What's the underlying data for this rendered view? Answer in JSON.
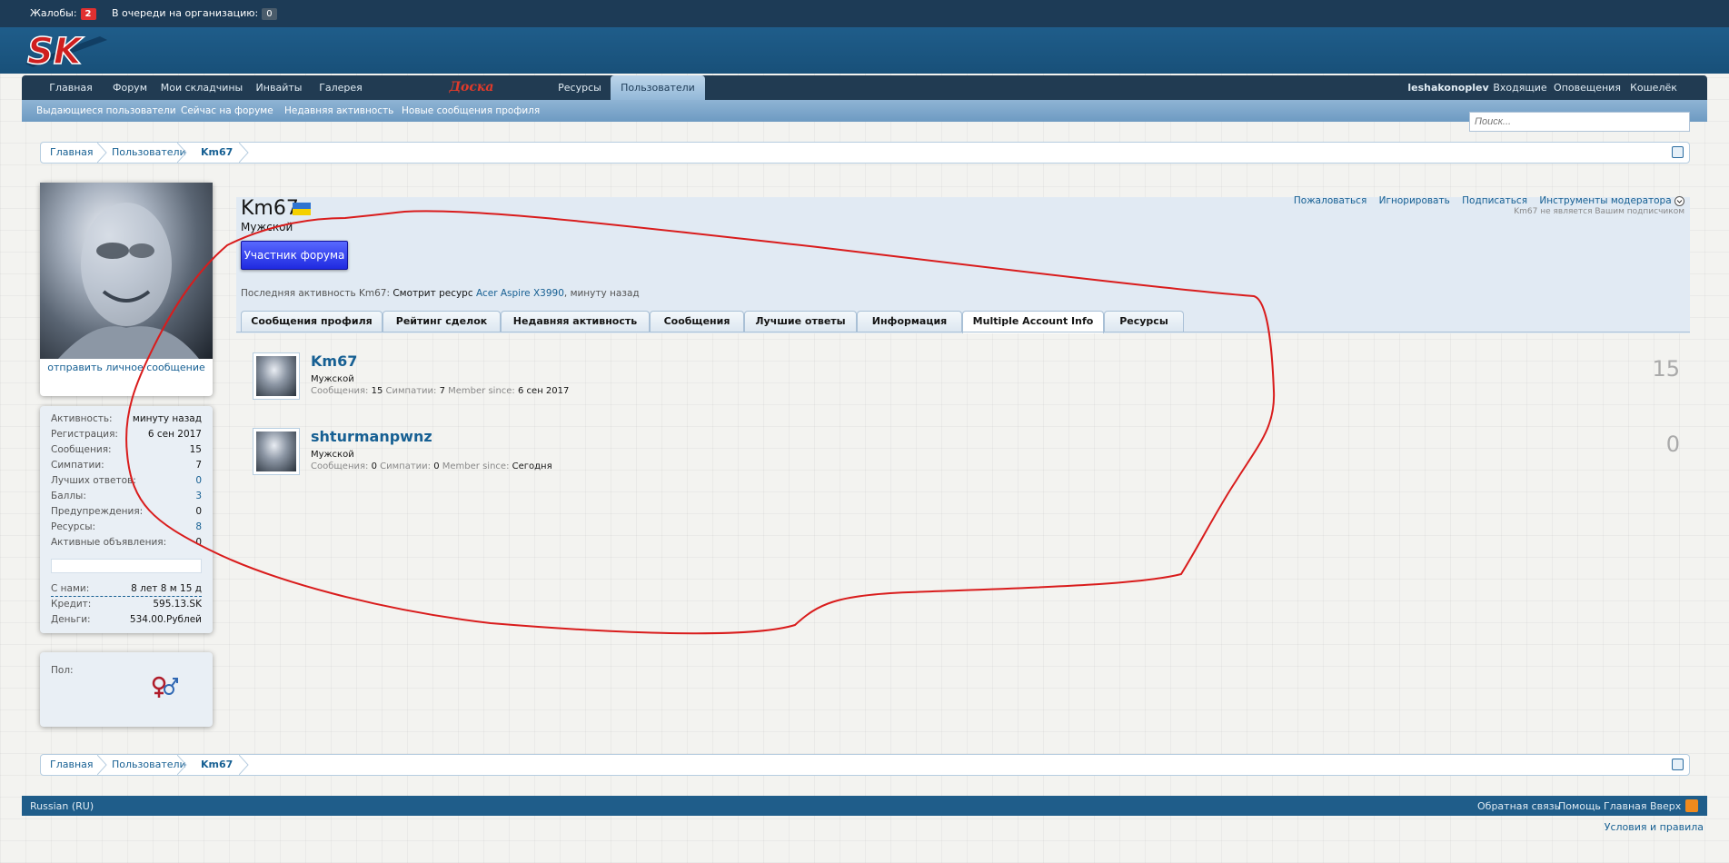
{
  "topbar": {
    "complaints_label": "Жалобы:",
    "complaints_count": "2",
    "queue_label": "В очереди на организацию:",
    "queue_count": "0"
  },
  "logo": {
    "text": "SK"
  },
  "nav": {
    "tabs": [
      "Главная",
      "Форум",
      "Мои складчины",
      "Инвайты",
      "Галерея",
      "Доска объявлений",
      "Ресурсы",
      "Пользователи"
    ],
    "selected": "Пользователи",
    "right": [
      "leshakonoplev",
      "Входящие",
      "Оповещения",
      "Кошелёк"
    ]
  },
  "subnav": [
    "Выдающиеся пользователи",
    "Сейчас на форуме",
    "Недавняя активность",
    "Новые сообщения профиля"
  ],
  "search": {
    "placeholder": "Поиск..."
  },
  "breadcrumb": [
    "Главная",
    "Пользователи",
    "Km67"
  ],
  "profile": {
    "username": "Km67",
    "user_title": "Мужской",
    "banner": "Участник форума",
    "last_activity_label": "Последняя активность Km67:",
    "last_activity_action": "Смотрит ресурс",
    "last_activity_resource": "Acer Aspire X3990",
    "last_activity_time": ", минуту назад",
    "mod_links": [
      "Пожаловаться",
      "Игнорировать",
      "Подписаться",
      "Инструменты модератора"
    ],
    "not_following": "Km67 не является Вашим подписчиком"
  },
  "sidebar": {
    "send_message": "отправить личное сообщение",
    "stats": [
      {
        "k": "Активность:",
        "v": "минуту назад"
      },
      {
        "k": "Регистрация:",
        "v": "6 сен 2017"
      },
      {
        "k": "Сообщения:",
        "v": "15"
      },
      {
        "k": "Симпатии:",
        "v": "7"
      },
      {
        "k": "Лучших ответов:",
        "v": "0"
      },
      {
        "k": "Баллы:",
        "v": "3"
      },
      {
        "k": "Предупреждения:",
        "v": "0"
      },
      {
        "k": "Ресурсы:",
        "v": "8"
      },
      {
        "k": "Активные объявления:",
        "v": "0"
      }
    ],
    "with_us_label": "С нами:",
    "with_us_value": "8 лет 8 м 15 д",
    "credit_label": "Кредит:",
    "credit_value": "595.13.SK",
    "money_label": "Деньги:",
    "money_value": "534.00.Рублей",
    "gender_label": "Пол:"
  },
  "tabs": [
    "Сообщения профиля",
    "Рейтинг сделок",
    "Недавняя активность",
    "Сообщения",
    "Лучшие ответы",
    "Информация",
    "Multiple Account Info",
    "Ресурсы"
  ],
  "selected_tab": "Multiple Account Info",
  "accounts": [
    {
      "name": "Km67",
      "title": "Мужской",
      "posts_label": "Сообщения:",
      "posts": "15",
      "likes_label": "Симпатии:",
      "likes": "7",
      "since_label": "Member since:",
      "since": "6 сен 2017",
      "count": "15"
    },
    {
      "name": "shturmanpwnz",
      "title": "Мужской",
      "posts_label": "Сообщения:",
      "posts": "0",
      "likes_label": "Симпатии:",
      "likes": "0",
      "since_label": "Member since:",
      "since": "Сегодня",
      "count": "0"
    }
  ],
  "footer": {
    "language": "Russian (RU)",
    "links": [
      "Обратная связь",
      "Помощь",
      "Главная",
      "Вверх"
    ],
    "terms": "Условия и правила"
  },
  "colors": {
    "accent": "#176093",
    "header": "#1f5d8a",
    "nav": "#213b52",
    "annotation": "#d91c1c",
    "badge": "#e03030"
  }
}
